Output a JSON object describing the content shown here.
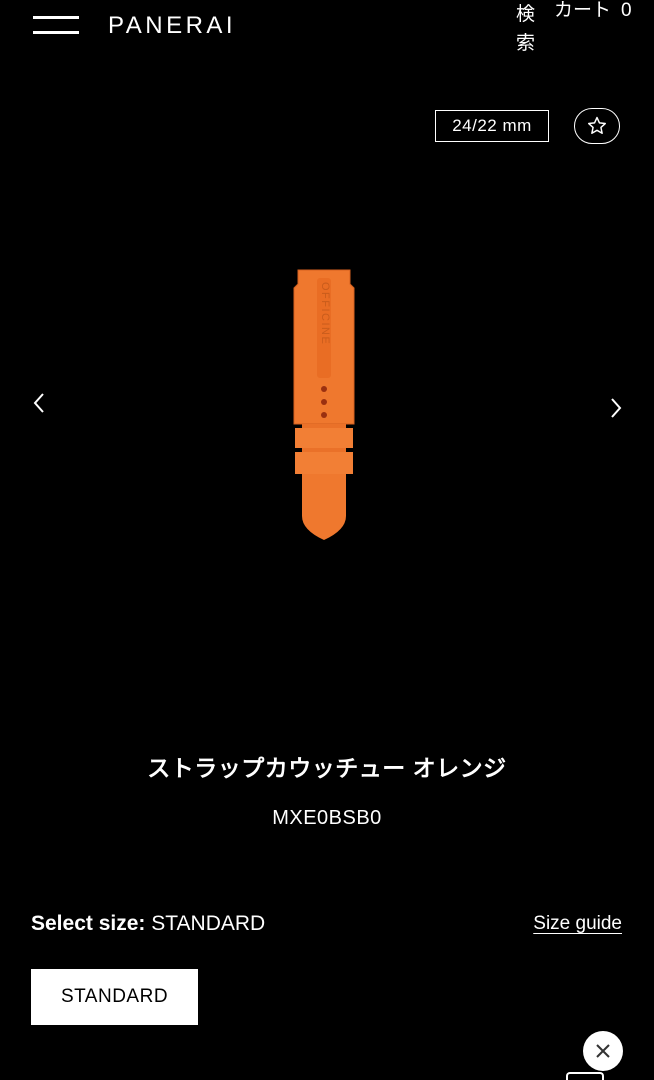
{
  "header": {
    "logo": "PANERAI",
    "search_label": "検索",
    "cart_label": "カート",
    "cart_count": "0"
  },
  "product": {
    "size_badge": "24/22 mm",
    "title": "ストラップカウッチュー オレンジ",
    "sku": "MXE0BSB0",
    "strap_color": "#f0782f",
    "strap_text": "OFFICINE"
  },
  "size_selector": {
    "label": "Select size:",
    "selected": "STANDARD",
    "guide_link": "Size guide",
    "options": [
      "STANDARD"
    ]
  },
  "icons": {
    "menu": "hamburger-menu-icon",
    "wishlist": "star-icon",
    "prev": "chevron-left-icon",
    "next": "chevron-right-icon",
    "close": "close-icon"
  },
  "colors": {
    "background": "#000000",
    "foreground": "#ffffff"
  }
}
